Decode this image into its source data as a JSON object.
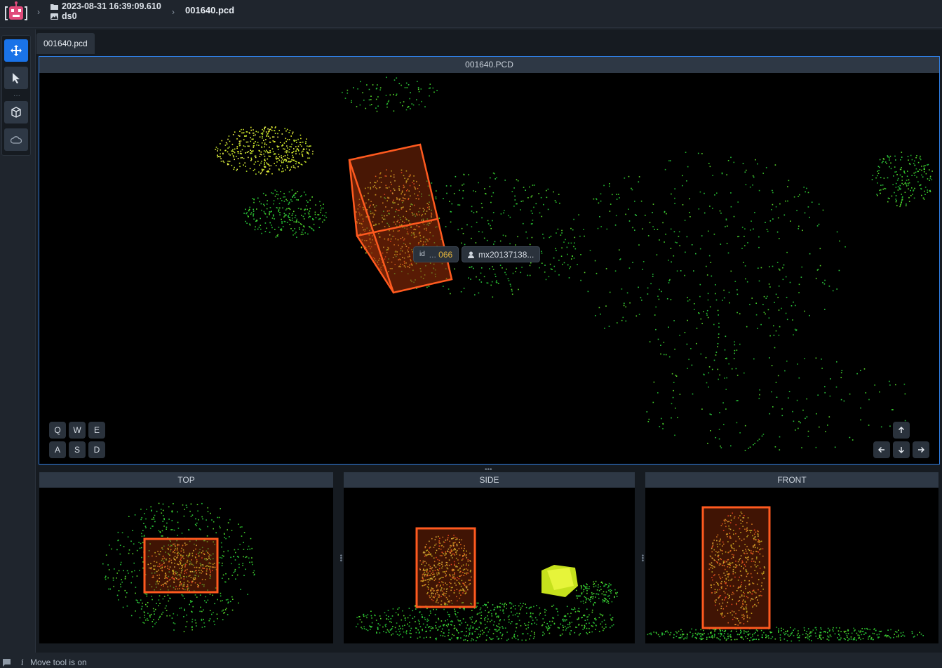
{
  "header": {
    "breadcrumb_date": "2023-08-31 16:39:09.610",
    "breadcrumb_dataset": "ds0",
    "breadcrumb_file": "001640.pcd"
  },
  "toolbar": {
    "tools": [
      "move-tool",
      "select-tool",
      "cuboid-tool",
      "pointcloud-tool"
    ]
  },
  "tabs": [
    {
      "label": "001640.pcd"
    }
  ],
  "main_view": {
    "title": "001640.PCD",
    "label_chip": {
      "id_tag": "id",
      "id_prefix": "...",
      "id_value": "066",
      "user": "mx20137138..."
    },
    "keys_row1": [
      "Q",
      "W",
      "E"
    ],
    "keys_row2": [
      "A",
      "S",
      "D"
    ]
  },
  "panels": {
    "top": "TOP",
    "side": "SIDE",
    "front": "FRONT"
  },
  "status": {
    "text": "Move tool is on"
  },
  "colors": {
    "accent": "#1a73e8",
    "cuboid": "#ff5a1f",
    "chip_id": "#e3b43b"
  }
}
